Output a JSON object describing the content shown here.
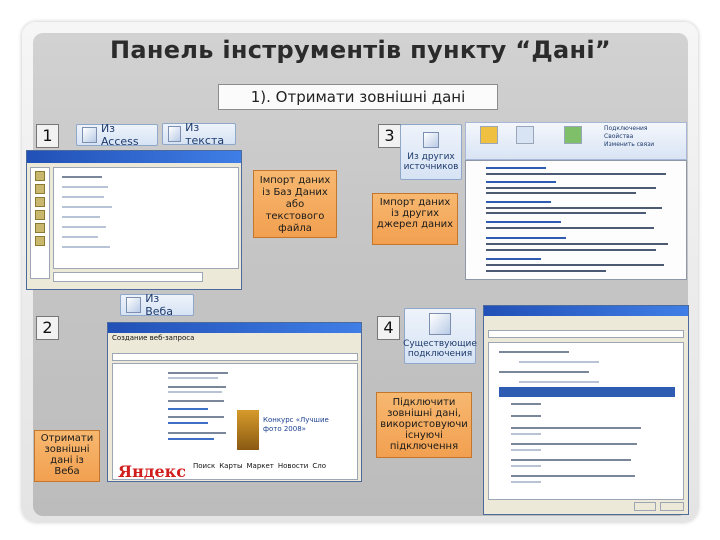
{
  "slide": {
    "title": "Панель інструментів пункту “Дані”",
    "subtitle": "1). Отримати зовнішні дані"
  },
  "quadrants": [
    {
      "number": "1",
      "caption": "Імпорт даних із Баз Даних або текстового файла",
      "buttons": [
        "Из Access",
        "Из текста"
      ]
    },
    {
      "number": "2",
      "caption": "Отримати зовнішні дані із Веба",
      "buttons": [
        "Из Веба"
      ]
    },
    {
      "number": "3",
      "caption": "Імпорт даних із других джерел даних",
      "buttons": [
        "Из других источников"
      ]
    },
    {
      "number": "4",
      "caption": "Підключити зовнішні дані, використовуючи існуючі підключення",
      "buttons": [
        "Существующие подключения"
      ]
    }
  ],
  "web_window": {
    "title": "Создание веб-запроса",
    "promo": "Конкурс «Лучшие фото 2008»",
    "logo": "Яндекс",
    "nav_items": [
      "Поиск",
      "Карты",
      "Маркет",
      "Новости",
      "Сло"
    ]
  },
  "ribbon3": {
    "top_items": [
      "Подключения",
      "Свойства",
      "Изменить связи"
    ]
  },
  "colors": {
    "accent_orange": "#f2a050",
    "frame_gray": "#c6c6c6"
  }
}
